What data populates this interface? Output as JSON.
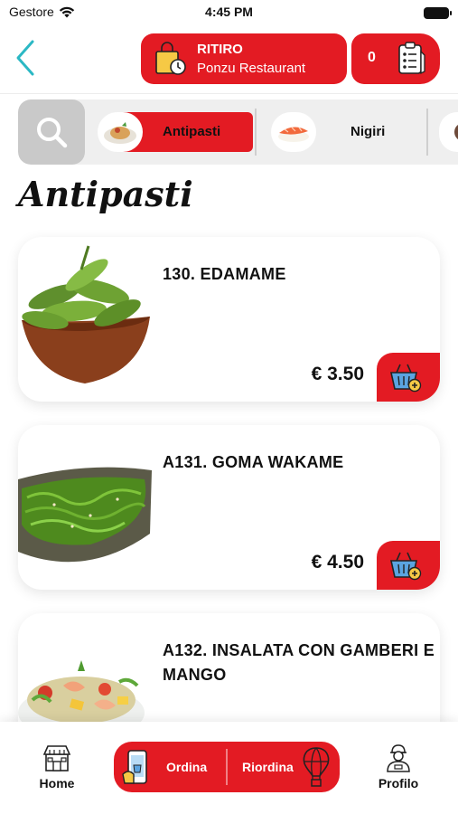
{
  "status_bar": {
    "carrier": "Gestore",
    "time": "4:45 PM"
  },
  "header": {
    "mode_label": "RITIRO",
    "restaurant": "Ponzu Restaurant",
    "cart_count": "0"
  },
  "categories": [
    {
      "name": "Antipasti",
      "active": true
    },
    {
      "name": "Nigiri",
      "active": false
    }
  ],
  "section_title": "Antipasti",
  "products": [
    {
      "name": "130. EDAMAME",
      "price": "€ 3.50"
    },
    {
      "name": "A131. GOMA WAKAME",
      "price": "€ 4.50"
    },
    {
      "name": "A132. INSALATA CON GAMBERI E MANGO",
      "price": ""
    }
  ],
  "bottom_nav": {
    "home": "Home",
    "order": "Ordina",
    "reorder": "Riordina",
    "profile": "Profilo"
  },
  "colors": {
    "brand_red": "#e31b23",
    "accent_teal": "#2bb8c4"
  }
}
